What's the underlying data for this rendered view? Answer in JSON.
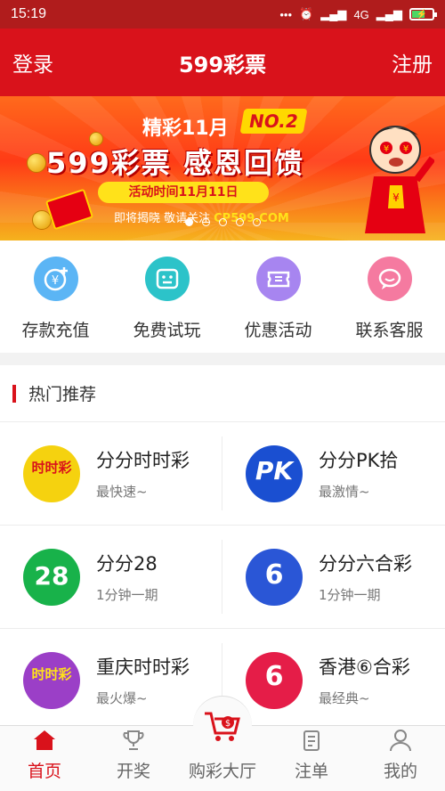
{
  "status_bar": {
    "time": "15:19",
    "network": "4G"
  },
  "header": {
    "login": "登录",
    "title": "599彩票",
    "register": "注册"
  },
  "banner": {
    "line1": "精彩11月",
    "badge": "NO.2",
    "line2": "599彩票 感恩回馈",
    "pill": "活动时间11月11日",
    "line4": "即将揭晓 敬请关注",
    "domain": "CP599.COM",
    "slide_count": 5,
    "active_slide": 1
  },
  "quick_actions": [
    {
      "label": "存款充值",
      "icon": "yuan-icon",
      "color": "#5bb5f5"
    },
    {
      "label": "免费试玩",
      "icon": "gamepad-icon",
      "color": "#2cc3c9"
    },
    {
      "label": "优惠活动",
      "icon": "ticket-icon",
      "color": "#a785f0"
    },
    {
      "label": "联系客服",
      "icon": "chat-icon",
      "color": "#f57aa0"
    }
  ],
  "hot": {
    "title": "热门推荐",
    "games": [
      {
        "name": "分分时时彩",
        "sub": "最快速~",
        "logo_text": "时时彩",
        "logo_color": "#f5d20f"
      },
      {
        "name": "分分PK拾",
        "sub": "最激情~",
        "logo_text": "PK",
        "logo_color": "#1a4fd1"
      },
      {
        "name": "分分28",
        "sub": "1分钟一期",
        "logo_text": "28",
        "logo_color": "#18b24a"
      },
      {
        "name": "分分六合彩",
        "sub": "1分钟一期",
        "logo_text": "6",
        "logo_color": "#2a56d6"
      },
      {
        "name": "重庆时时彩",
        "sub": "最火爆~",
        "logo_text": "时时彩",
        "logo_color": "#9b3fc7"
      },
      {
        "name": "香港⑥合彩",
        "sub": "最经典~",
        "logo_text": "6",
        "logo_color": "#e51d48"
      }
    ]
  },
  "tabs": [
    {
      "label": "首页",
      "icon": "home-icon",
      "active": true
    },
    {
      "label": "开奖",
      "icon": "trophy-icon",
      "active": false
    },
    {
      "label": "购彩大厅",
      "icon": "cart-icon",
      "active": false
    },
    {
      "label": "注单",
      "icon": "clipboard-icon",
      "active": false
    },
    {
      "label": "我的",
      "icon": "user-icon",
      "active": false
    }
  ],
  "colors": {
    "brand_red": "#d9121b",
    "status_bar": "#b01c1c"
  }
}
